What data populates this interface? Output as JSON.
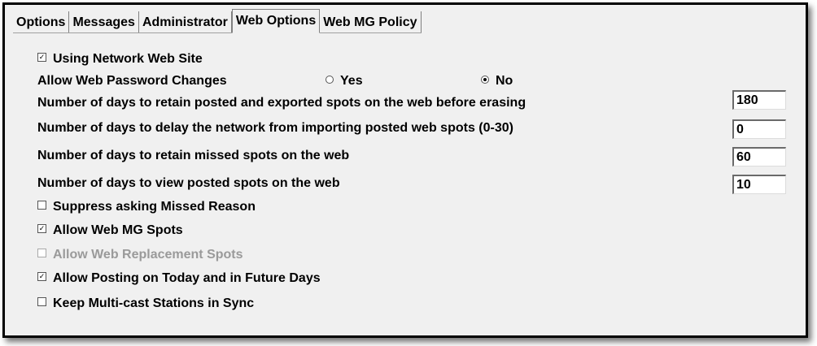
{
  "tabs": [
    {
      "label": "Options",
      "active": false
    },
    {
      "label": "Messages",
      "active": false
    },
    {
      "label": "Administrator",
      "active": false
    },
    {
      "label": "Web Options",
      "active": true
    },
    {
      "label": "Web MG Policy",
      "active": false
    }
  ],
  "settings": {
    "using_network_web_site": {
      "label": "Using Network Web Site",
      "checked": true
    },
    "allow_web_password_changes": {
      "label": "Allow Web Password Changes",
      "yes_label": "Yes",
      "no_label": "No",
      "selected": "No"
    },
    "retain_posted_days": {
      "label": "Number of days to retain posted and exported spots on the web before erasing",
      "value": "180"
    },
    "delay_import_days": {
      "label": "Number of days to delay the network from importing posted web spots (0-30)",
      "value": "0"
    },
    "retain_missed_days": {
      "label": "Number of days to retain missed spots on the web",
      "value": "60"
    },
    "view_posted_days": {
      "label": "Number of days to view posted spots on the web",
      "value": "10"
    },
    "suppress_missed_reason": {
      "label": "Suppress asking Missed Reason",
      "checked": false
    },
    "allow_web_mg_spots": {
      "label": "Allow Web MG Spots",
      "checked": true
    },
    "allow_web_replacement_spots": {
      "label": "Allow Web Replacement Spots",
      "checked": false,
      "disabled": true
    },
    "allow_posting_today_future": {
      "label": "Allow Posting on Today and in Future Days",
      "checked": true
    },
    "keep_multicast_sync": {
      "label": "Keep Multi-cast Stations in Sync",
      "checked": false
    }
  }
}
